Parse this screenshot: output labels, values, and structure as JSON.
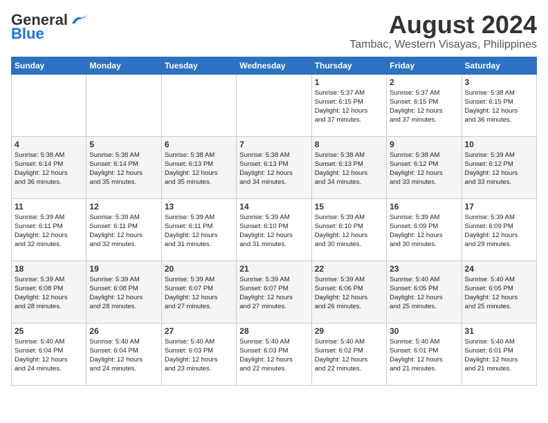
{
  "header": {
    "logo_general": "General",
    "logo_blue": "Blue",
    "month_title": "August 2024",
    "location": "Tambac, Western Visayas, Philippines"
  },
  "calendar": {
    "days_of_week": [
      "Sunday",
      "Monday",
      "Tuesday",
      "Wednesday",
      "Thursday",
      "Friday",
      "Saturday"
    ],
    "weeks": [
      [
        {
          "day": "",
          "info": ""
        },
        {
          "day": "",
          "info": ""
        },
        {
          "day": "",
          "info": ""
        },
        {
          "day": "",
          "info": ""
        },
        {
          "day": "1",
          "info": "Sunrise: 5:37 AM\nSunset: 6:15 PM\nDaylight: 12 hours\nand 37 minutes."
        },
        {
          "day": "2",
          "info": "Sunrise: 5:37 AM\nSunset: 6:15 PM\nDaylight: 12 hours\nand 37 minutes."
        },
        {
          "day": "3",
          "info": "Sunrise: 5:38 AM\nSunset: 6:15 PM\nDaylight: 12 hours\nand 36 minutes."
        }
      ],
      [
        {
          "day": "4",
          "info": "Sunrise: 5:38 AM\nSunset: 6:14 PM\nDaylight: 12 hours\nand 36 minutes."
        },
        {
          "day": "5",
          "info": "Sunrise: 5:38 AM\nSunset: 6:14 PM\nDaylight: 12 hours\nand 35 minutes."
        },
        {
          "day": "6",
          "info": "Sunrise: 5:38 AM\nSunset: 6:13 PM\nDaylight: 12 hours\nand 35 minutes."
        },
        {
          "day": "7",
          "info": "Sunrise: 5:38 AM\nSunset: 6:13 PM\nDaylight: 12 hours\nand 34 minutes."
        },
        {
          "day": "8",
          "info": "Sunrise: 5:38 AM\nSunset: 6:13 PM\nDaylight: 12 hours\nand 34 minutes."
        },
        {
          "day": "9",
          "info": "Sunrise: 5:38 AM\nSunset: 6:12 PM\nDaylight: 12 hours\nand 33 minutes."
        },
        {
          "day": "10",
          "info": "Sunrise: 5:39 AM\nSunset: 6:12 PM\nDaylight: 12 hours\nand 33 minutes."
        }
      ],
      [
        {
          "day": "11",
          "info": "Sunrise: 5:39 AM\nSunset: 6:11 PM\nDaylight: 12 hours\nand 32 minutes."
        },
        {
          "day": "12",
          "info": "Sunrise: 5:39 AM\nSunset: 6:11 PM\nDaylight: 12 hours\nand 32 minutes."
        },
        {
          "day": "13",
          "info": "Sunrise: 5:39 AM\nSunset: 6:11 PM\nDaylight: 12 hours\nand 31 minutes."
        },
        {
          "day": "14",
          "info": "Sunrise: 5:39 AM\nSunset: 6:10 PM\nDaylight: 12 hours\nand 31 minutes."
        },
        {
          "day": "15",
          "info": "Sunrise: 5:39 AM\nSunset: 6:10 PM\nDaylight: 12 hours\nand 30 minutes."
        },
        {
          "day": "16",
          "info": "Sunrise: 5:39 AM\nSunset: 6:09 PM\nDaylight: 12 hours\nand 30 minutes."
        },
        {
          "day": "17",
          "info": "Sunrise: 5:39 AM\nSunset: 6:09 PM\nDaylight: 12 hours\nand 29 minutes."
        }
      ],
      [
        {
          "day": "18",
          "info": "Sunrise: 5:39 AM\nSunset: 6:08 PM\nDaylight: 12 hours\nand 28 minutes."
        },
        {
          "day": "19",
          "info": "Sunrise: 5:39 AM\nSunset: 6:08 PM\nDaylight: 12 hours\nand 28 minutes."
        },
        {
          "day": "20",
          "info": "Sunrise: 5:39 AM\nSunset: 6:07 PM\nDaylight: 12 hours\nand 27 minutes."
        },
        {
          "day": "21",
          "info": "Sunrise: 5:39 AM\nSunset: 6:07 PM\nDaylight: 12 hours\nand 27 minutes."
        },
        {
          "day": "22",
          "info": "Sunrise: 5:39 AM\nSunset: 6:06 PM\nDaylight: 12 hours\nand 26 minutes."
        },
        {
          "day": "23",
          "info": "Sunrise: 5:40 AM\nSunset: 6:05 PM\nDaylight: 12 hours\nand 25 minutes."
        },
        {
          "day": "24",
          "info": "Sunrise: 5:40 AM\nSunset: 6:05 PM\nDaylight: 12 hours\nand 25 minutes."
        }
      ],
      [
        {
          "day": "25",
          "info": "Sunrise: 5:40 AM\nSunset: 6:04 PM\nDaylight: 12 hours\nand 24 minutes."
        },
        {
          "day": "26",
          "info": "Sunrise: 5:40 AM\nSunset: 6:04 PM\nDaylight: 12 hours\nand 24 minutes."
        },
        {
          "day": "27",
          "info": "Sunrise: 5:40 AM\nSunset: 6:03 PM\nDaylight: 12 hours\nand 23 minutes."
        },
        {
          "day": "28",
          "info": "Sunrise: 5:40 AM\nSunset: 6:03 PM\nDaylight: 12 hours\nand 22 minutes."
        },
        {
          "day": "29",
          "info": "Sunrise: 5:40 AM\nSunset: 6:02 PM\nDaylight: 12 hours\nand 22 minutes."
        },
        {
          "day": "30",
          "info": "Sunrise: 5:40 AM\nSunset: 6:01 PM\nDaylight: 12 hours\nand 21 minutes."
        },
        {
          "day": "31",
          "info": "Sunrise: 5:40 AM\nSunset: 6:01 PM\nDaylight: 12 hours\nand 21 minutes."
        }
      ]
    ]
  }
}
